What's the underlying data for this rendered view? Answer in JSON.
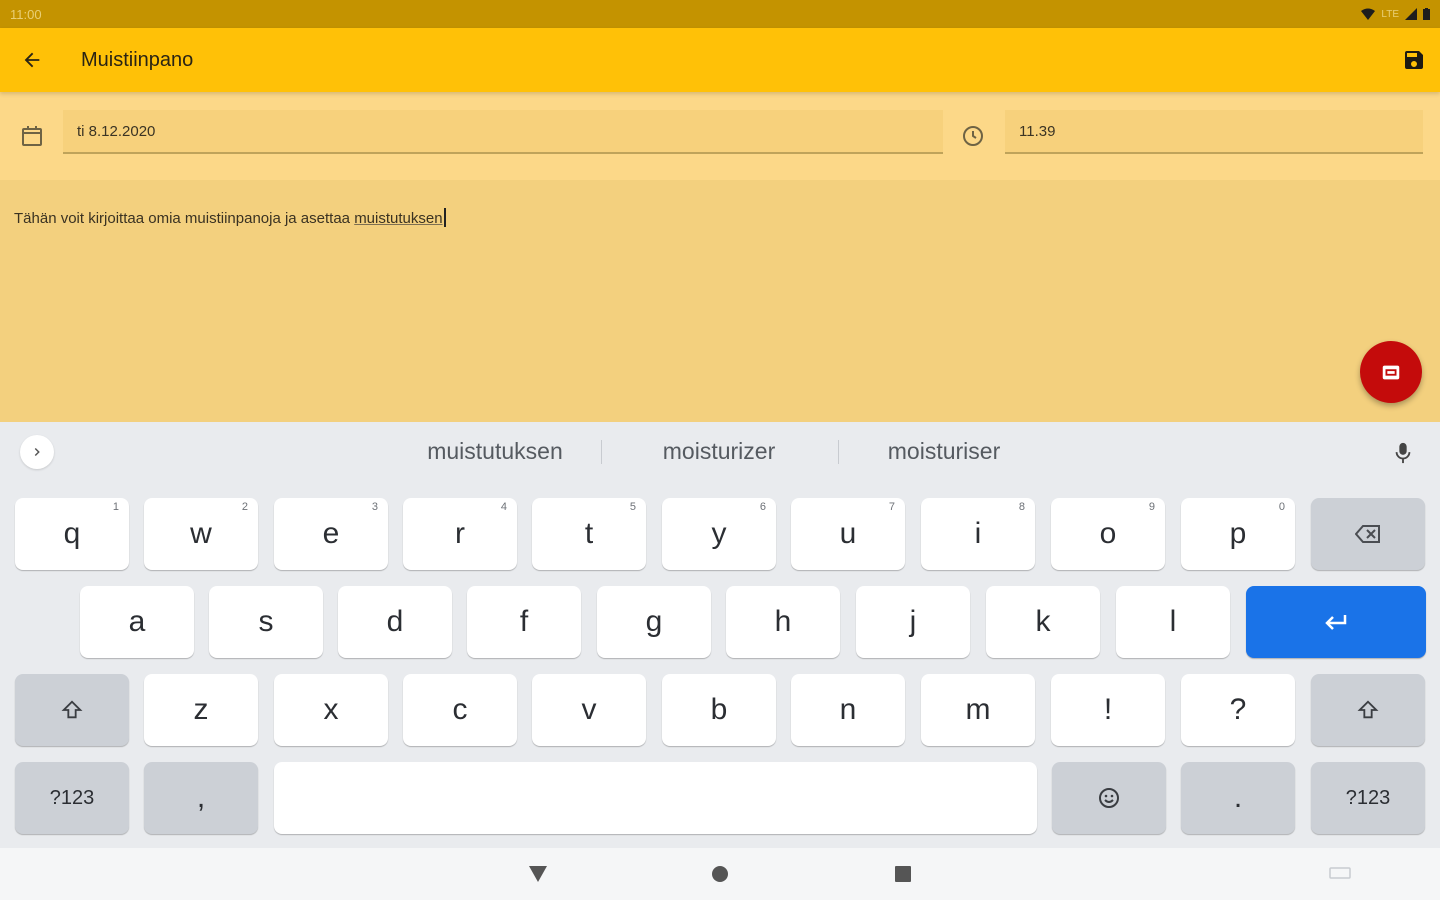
{
  "status": {
    "time": "11:00",
    "network": "LTE"
  },
  "appbar": {
    "title": "Muistiinpano"
  },
  "fields": {
    "date": "ti 8.12.2020",
    "time": "11.39"
  },
  "note": {
    "text_before": "Tähän voit kirjoittaa omia muistiinpanoja ja asettaa ",
    "underlined_word": "muistutuksen"
  },
  "keyboard": {
    "suggestions": [
      "muistutuksen",
      "moisturizer",
      "moisturiser"
    ],
    "row1": [
      {
        "label": "q",
        "hint": "1"
      },
      {
        "label": "w",
        "hint": "2"
      },
      {
        "label": "e",
        "hint": "3"
      },
      {
        "label": "r",
        "hint": "4"
      },
      {
        "label": "t",
        "hint": "5"
      },
      {
        "label": "y",
        "hint": "6"
      },
      {
        "label": "u",
        "hint": "7"
      },
      {
        "label": "i",
        "hint": "8"
      },
      {
        "label": "o",
        "hint": "9"
      },
      {
        "label": "p",
        "hint": "0"
      }
    ],
    "row2": [
      "a",
      "s",
      "d",
      "f",
      "g",
      "h",
      "j",
      "k",
      "l"
    ],
    "row3": [
      "z",
      "x",
      "c",
      "v",
      "b",
      "n",
      "m",
      "!",
      "?"
    ],
    "row4": {
      "symbols_left": "?123",
      "comma": ",",
      "period": ".",
      "symbols_right": "?123"
    }
  },
  "colors": {
    "appbar": "#ffc107",
    "statusbar": "#c49300",
    "fab": "#c40b0b",
    "enter": "#1a73e8"
  }
}
